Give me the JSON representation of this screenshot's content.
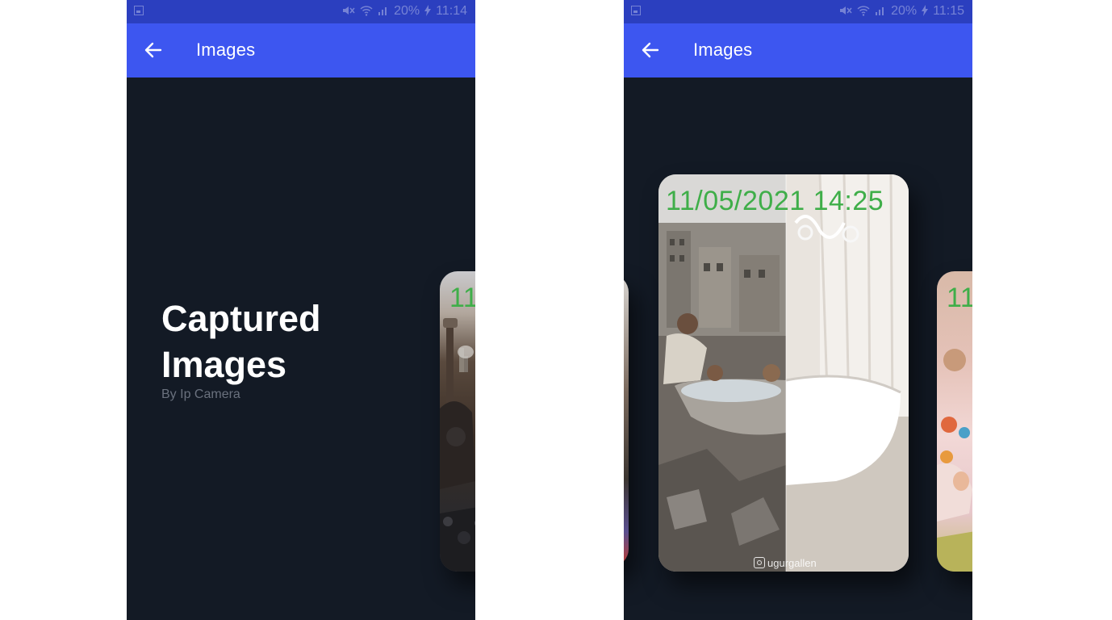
{
  "screens": [
    {
      "status_bar": {
        "battery": "20%",
        "time": "11:14"
      },
      "app_bar": {
        "title": "Images"
      },
      "hero": {
        "title_line1": "Captured",
        "title_line2": "Images",
        "subtitle": "By Ip Camera"
      },
      "peek_card": {
        "stamp": "11"
      }
    },
    {
      "status_bar": {
        "battery": "20%",
        "time": "11:15"
      },
      "app_bar": {
        "title": "Images"
      },
      "center_card": {
        "stamp": "11/05/2021 14:25",
        "watermark": "ugurgallen"
      },
      "peek_card": {
        "stamp": "11"
      }
    }
  ],
  "icons": {
    "status_left": "image-icon",
    "status": [
      "mute-icon",
      "wifi-icon",
      "signal-icon",
      "charging-icon"
    ],
    "back": "back-arrow-icon",
    "watermark": "instagram-icon"
  },
  "colors": {
    "status_bar": "#2b3fbf",
    "app_bar": "#3d56f0",
    "background": "#131a25",
    "stamp": "#3fae49",
    "subtitle": "#6a717e"
  }
}
